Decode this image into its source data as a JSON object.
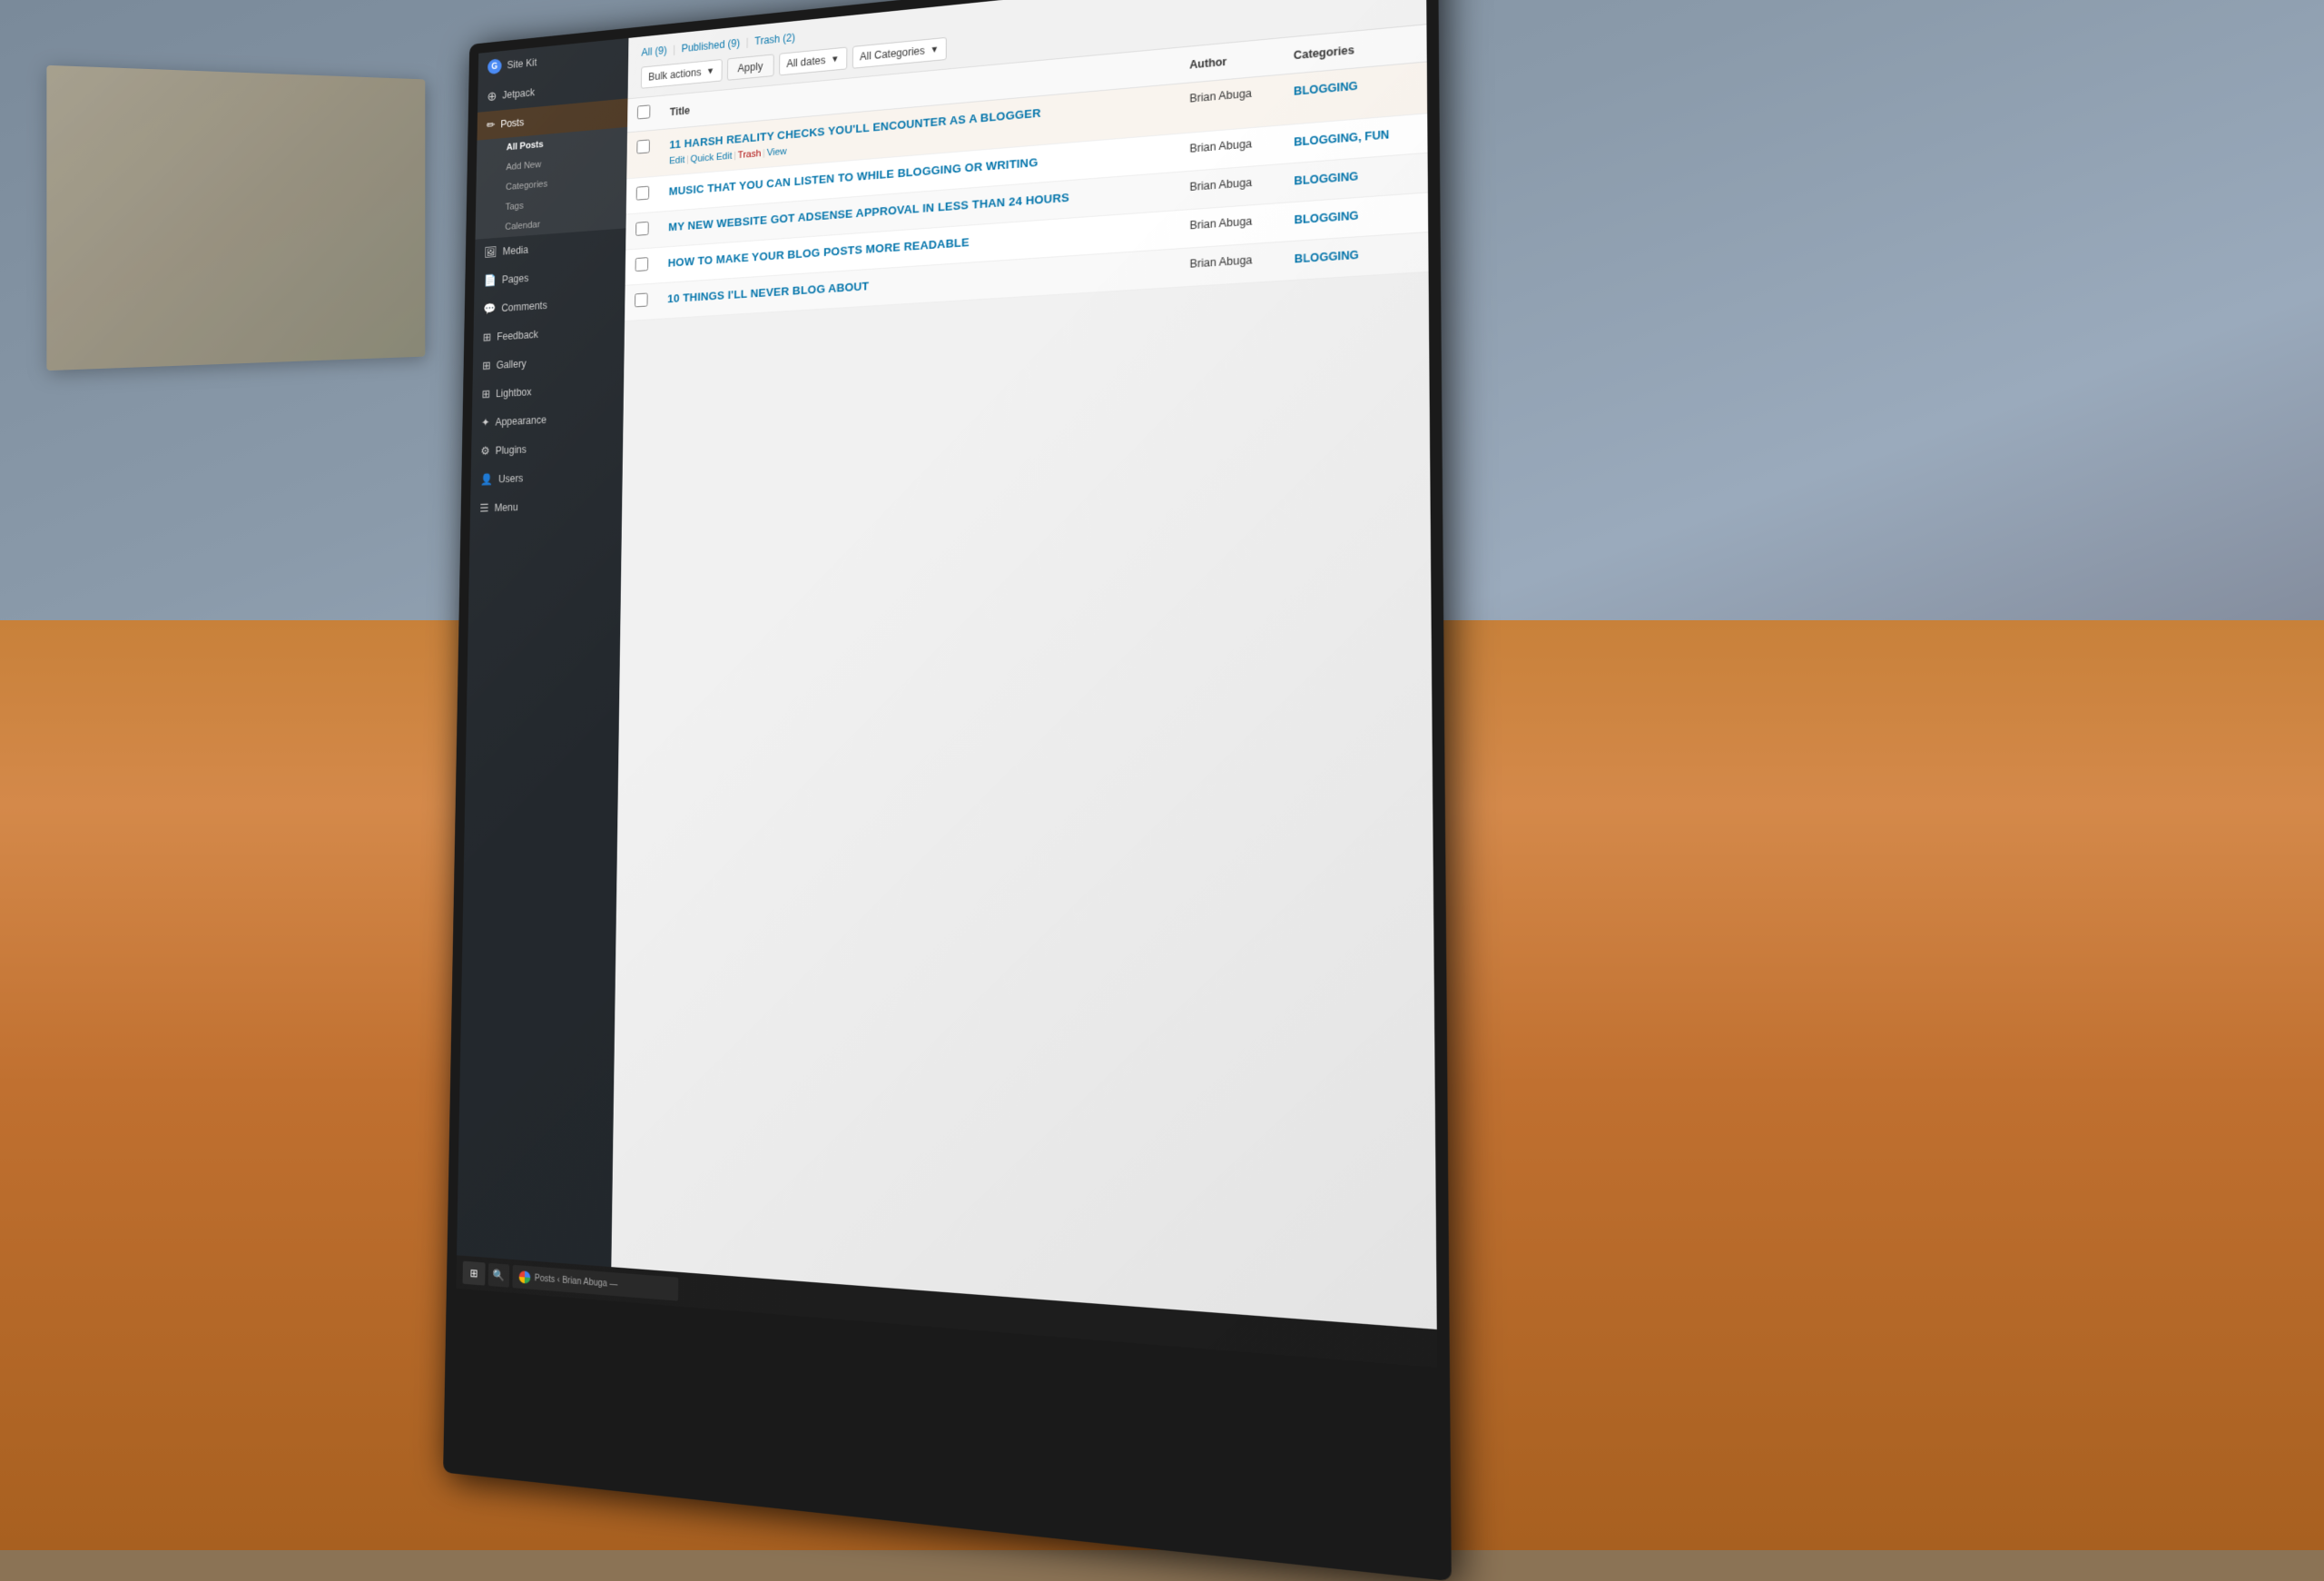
{
  "background": {
    "desk_color": "#c8813a",
    "wall_color": "#8a9aaa"
  },
  "sidebar": {
    "items": [
      {
        "id": "site-kit",
        "label": "Site Kit",
        "icon": "G"
      },
      {
        "id": "jetpack",
        "label": "Jetpack",
        "icon": "⊕"
      },
      {
        "id": "posts",
        "label": "Posts",
        "icon": "✏",
        "active": true
      },
      {
        "id": "media",
        "label": "Media",
        "icon": "🖼"
      },
      {
        "id": "pages",
        "label": "Pages",
        "icon": "📄"
      },
      {
        "id": "comments",
        "label": "Comments",
        "icon": "💬"
      },
      {
        "id": "feedback",
        "label": "Feedback",
        "icon": "⊞"
      },
      {
        "id": "gallery",
        "label": "Gallery",
        "icon": "⊞"
      },
      {
        "id": "lightbox",
        "label": "Lightbox",
        "icon": "⊞"
      },
      {
        "id": "appearance",
        "label": "Appearance",
        "icon": "🎨"
      },
      {
        "id": "plugins",
        "label": "Plugins",
        "icon": "🔌"
      },
      {
        "id": "users",
        "label": "Users",
        "icon": "👤"
      },
      {
        "id": "menu",
        "label": "Menu",
        "icon": "☰"
      }
    ],
    "posts_submenu": [
      {
        "id": "all-posts",
        "label": "All Posts",
        "active": true
      },
      {
        "id": "add-new",
        "label": "Add New"
      },
      {
        "id": "categories",
        "label": "Categories"
      },
      {
        "id": "tags",
        "label": "Tags"
      },
      {
        "id": "calendar",
        "label": "Calendar"
      }
    ]
  },
  "filter_bar": {
    "counts": {
      "all_label": "All",
      "all_count": "9",
      "published_label": "Published",
      "published_count": "9",
      "trash_label": "Trash",
      "trash_count": "2"
    },
    "bulk_actions_label": "Bulk actions",
    "apply_label": "Apply",
    "dates_label": "All dates",
    "categories_label": "All Categories"
  },
  "table": {
    "headers": {
      "title": "Title",
      "author": "Author",
      "categories": "Categories"
    },
    "posts": [
      {
        "id": 1,
        "title": "11 HARSH REALITY CHECKS YOU'LL ENCOUNTER AS A BLOGGER",
        "author": "Brian Abuga",
        "categories": "BLOGGING",
        "row_actions": {
          "edit": "Edit",
          "quick_edit": "Quick Edit",
          "trash": "Trash",
          "view": "View"
        }
      },
      {
        "id": 2,
        "title": "MUSIC THAT YOU CAN LISTEN TO WHILE BLOGGING OR WRITING",
        "author": "Brian Abuga",
        "categories": "BLOGGING, FUN",
        "row_actions": null
      },
      {
        "id": 3,
        "title": "MY NEW WEBSITE GOT ADSENSE APPROVAL IN LESS THAN 24 HOURS",
        "author": "Brian Abuga",
        "categories": "BLOGGING",
        "row_actions": null
      },
      {
        "id": 4,
        "title": "HOW TO MAKE YOUR BLOG POSTS MORE READABLE",
        "author": "Brian Abuga",
        "categories": "BLOGGING",
        "row_actions": null
      },
      {
        "id": 5,
        "title": "10 THINGS I'LL NEVER BLOG ABOUT",
        "author": "Brian Abuga",
        "categories": "BLOGGING",
        "row_actions": null
      }
    ]
  },
  "taskbar": {
    "browser_label": "Posts ‹ Brian Abuga —"
  }
}
